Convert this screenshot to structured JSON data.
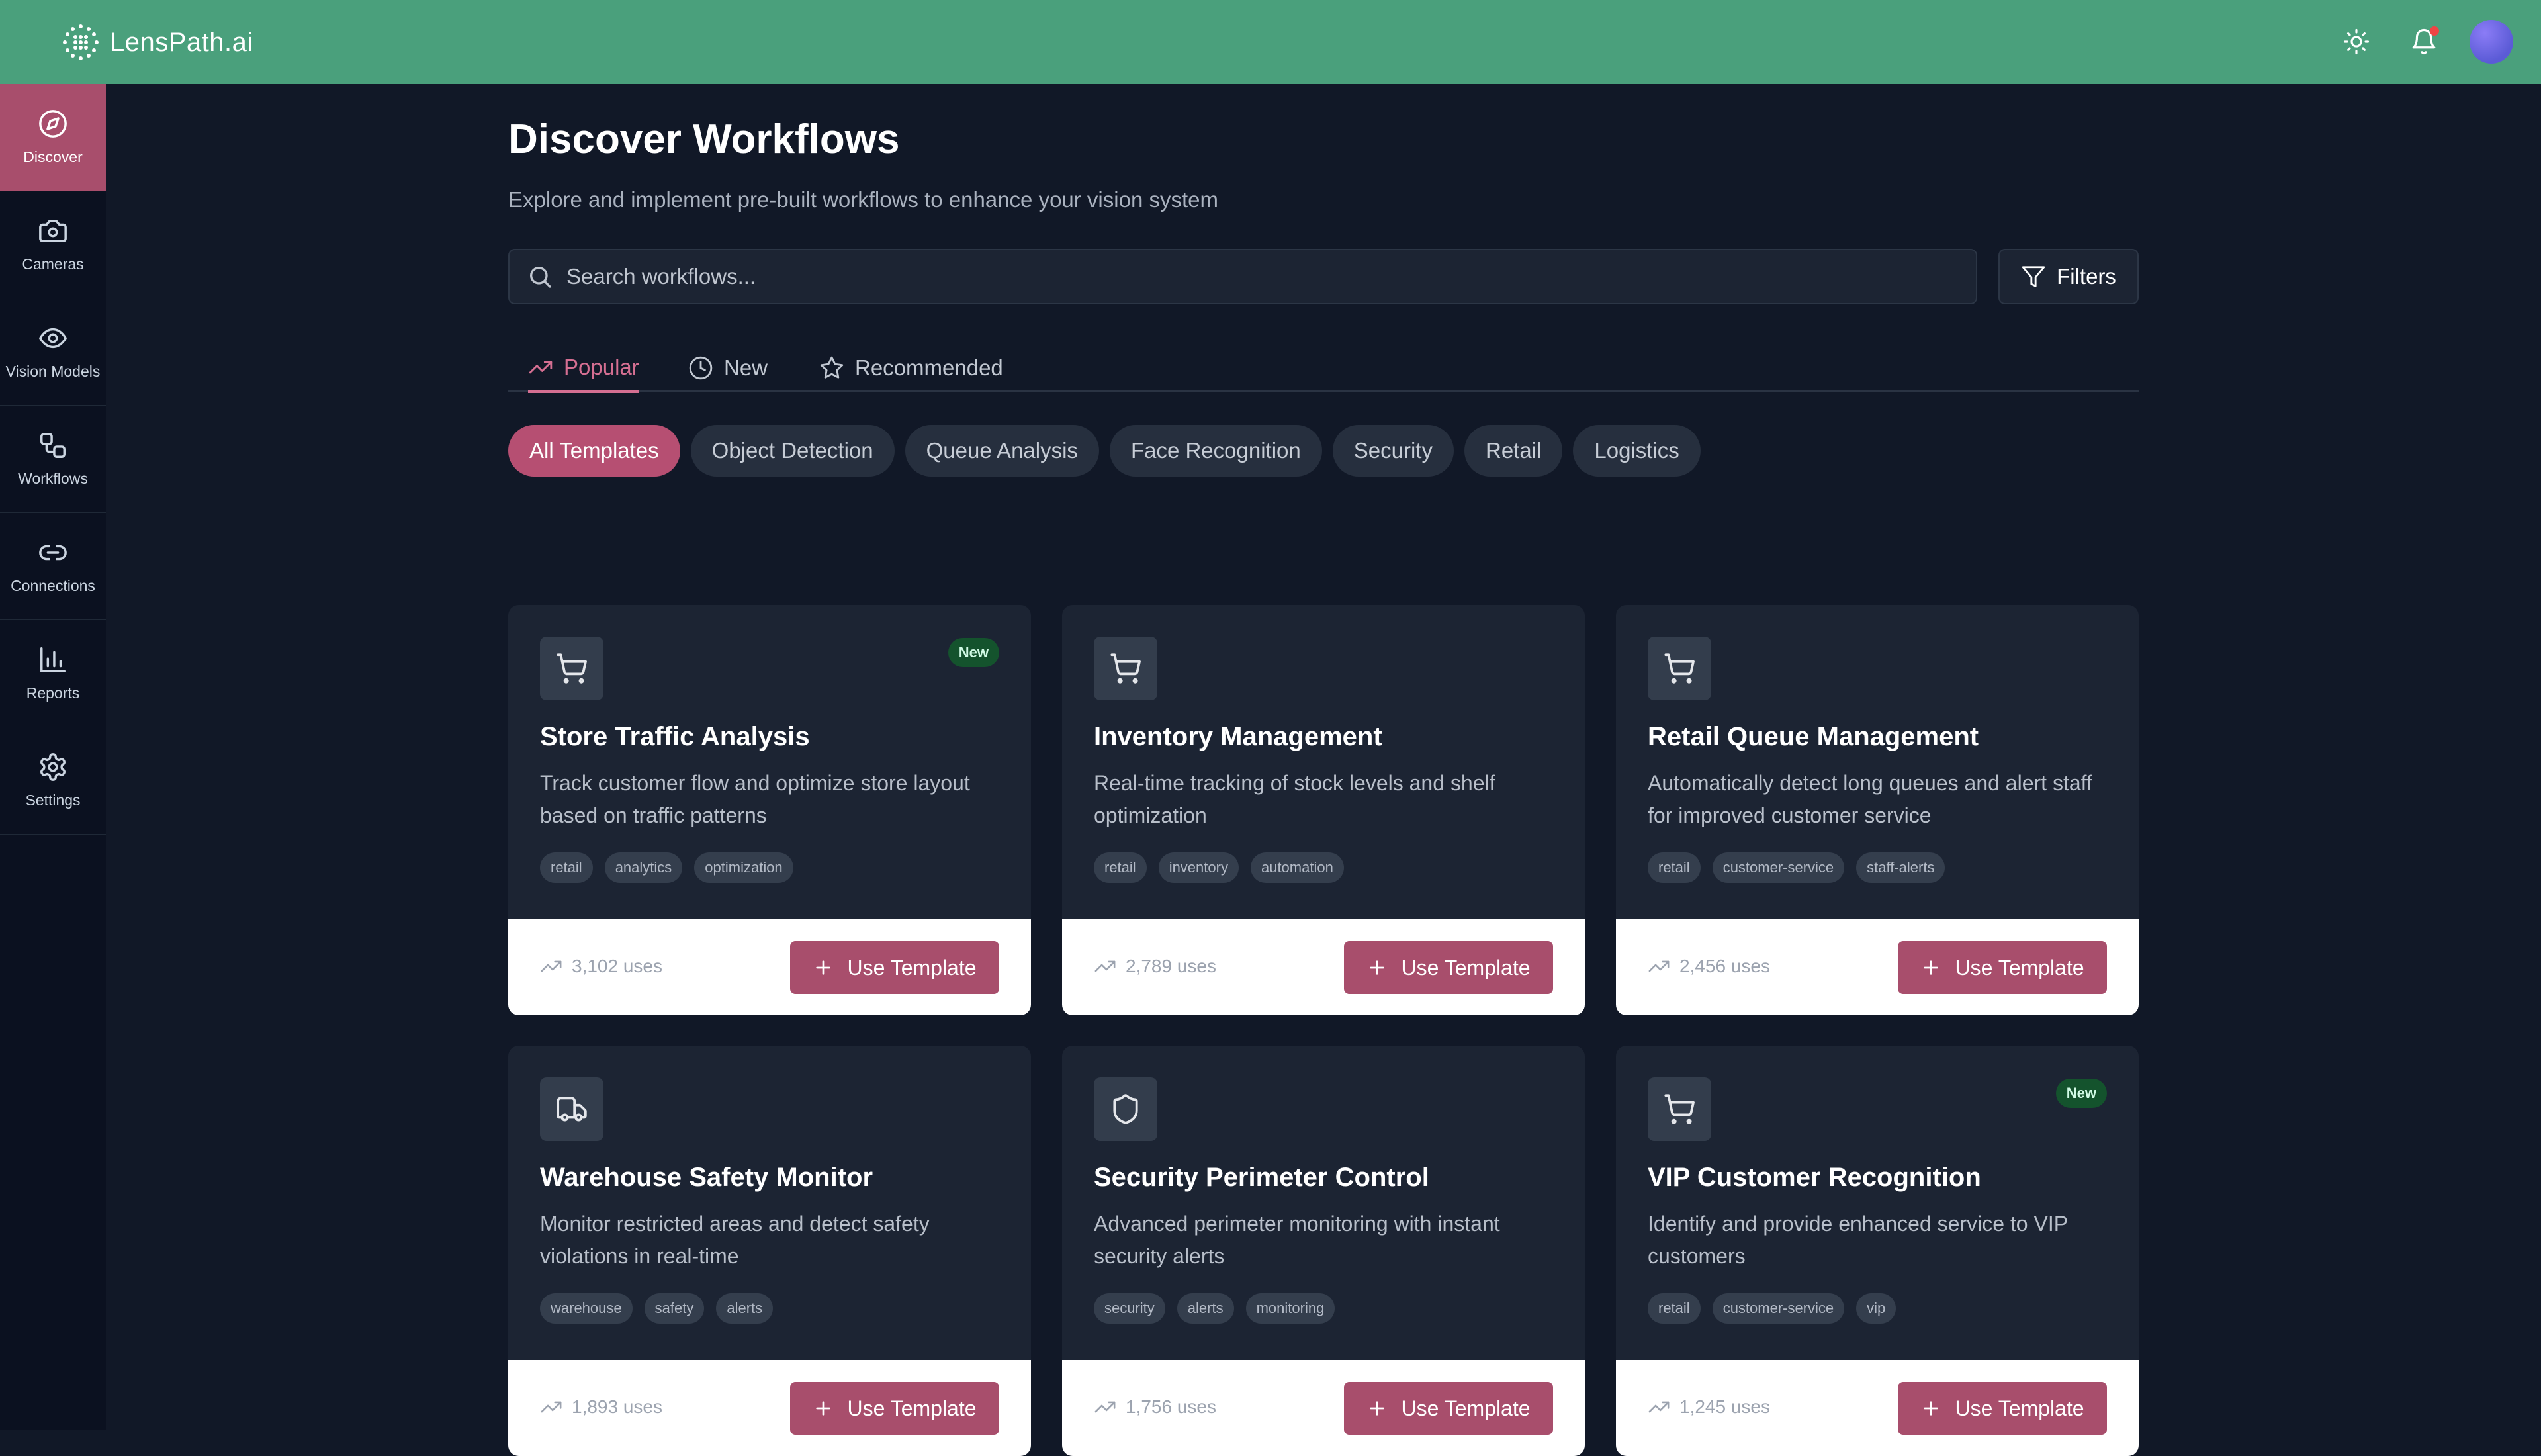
{
  "brand": {
    "name": "LensPath.ai"
  },
  "sidebar": {
    "items": [
      {
        "label": "Discover",
        "icon": "compass-icon",
        "active": true
      },
      {
        "label": "Cameras",
        "icon": "camera-icon"
      },
      {
        "label": "Vision Models",
        "icon": "eye-icon"
      },
      {
        "label": "Workflows",
        "icon": "workflow-icon"
      },
      {
        "label": "Connections",
        "icon": "link-icon"
      },
      {
        "label": "Reports",
        "icon": "bar-chart-icon"
      },
      {
        "label": "Settings",
        "icon": "gear-icon"
      }
    ]
  },
  "header": {
    "icons": [
      "sun-icon",
      "bell-icon",
      "avatar"
    ]
  },
  "main": {
    "title": "Discover Workflows",
    "subtitle": "Explore and implement pre-built workflows to enhance your vision system",
    "search": {
      "placeholder": "Search workflows...",
      "value": ""
    },
    "filters_label": "Filters",
    "tabs": [
      {
        "label": "Popular",
        "icon": "trending-up-icon",
        "active": true
      },
      {
        "label": "New",
        "icon": "clock-icon"
      },
      {
        "label": "Recommended",
        "icon": "star-icon"
      }
    ],
    "categories": [
      "All Templates",
      "Object Detection",
      "Queue Analysis",
      "Face Recognition",
      "Security",
      "Retail",
      "Logistics"
    ],
    "use_button_label": "Use Template",
    "new_badge_label": "New",
    "cards": [
      {
        "title": "Store Traffic Analysis",
        "description": "Track customer flow and optimize store layout based on traffic patterns",
        "tags": [
          "retail",
          "analytics",
          "optimization"
        ],
        "uses": "3,102 uses",
        "icon": "cart-icon",
        "is_new": true
      },
      {
        "title": "Inventory Management",
        "description": "Real-time tracking of stock levels and shelf optimization",
        "tags": [
          "retail",
          "inventory",
          "automation"
        ],
        "uses": "2,789 uses",
        "icon": "cart-icon",
        "is_new": false
      },
      {
        "title": "Retail Queue Management",
        "description": "Automatically detect long queues and alert staff for improved customer service",
        "tags": [
          "retail",
          "customer-service",
          "staff-alerts"
        ],
        "uses": "2,456 uses",
        "icon": "cart-icon",
        "is_new": false
      },
      {
        "title": "Warehouse Safety Monitor",
        "description": "Monitor restricted areas and detect safety violations in real-time",
        "tags": [
          "warehouse",
          "safety",
          "alerts"
        ],
        "uses": "1,893 uses",
        "icon": "truck-icon",
        "is_new": false
      },
      {
        "title": "Security Perimeter Control",
        "description": "Advanced perimeter monitoring with instant security alerts",
        "tags": [
          "security",
          "alerts",
          "monitoring"
        ],
        "uses": "1,756 uses",
        "icon": "shield-icon",
        "is_new": false
      },
      {
        "title": "VIP Customer Recognition",
        "description": "Identify and provide enhanced service to VIP customers",
        "tags": [
          "retail",
          "customer-service",
          "vip"
        ],
        "uses": "1,245 uses",
        "icon": "cart-icon",
        "is_new": true
      }
    ]
  },
  "colors": {
    "topbar": "#4aa07c",
    "accent": "#a84e6c",
    "accent_text": "#d56f92",
    "background": "#111827",
    "card": "#1c2433",
    "new_badge": "#14532d"
  }
}
